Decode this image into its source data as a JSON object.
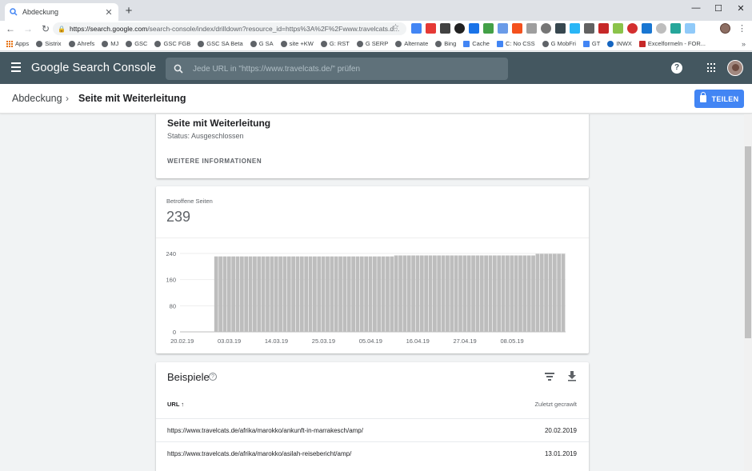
{
  "browser": {
    "tab_title": "Abdeckung",
    "new_tab": "+",
    "window_controls": [
      "—",
      "☐",
      "✕"
    ],
    "url_host": "https://search.google.com",
    "url_path": "/search-console/index/drilldown?resource_id=https%3A%2F%2Fwww.travelcats.d...",
    "bookmarks": [
      "Apps",
      "Sistrix",
      "Ahrefs",
      "MJ",
      "GSC",
      "GSC FGB",
      "GSC SA Beta",
      "G SA",
      "site +KW",
      "G: RST",
      "G SERP",
      "Alternate",
      "Bing",
      "Cache",
      "C: No CSS",
      "G MobFri",
      "GT",
      "INWX",
      "Excelformeln - FOR..."
    ],
    "more": "»"
  },
  "header": {
    "logo": "Google Search Console",
    "search_placeholder": "Jede URL in \"https://www.travelcats.de/\" prüfen",
    "help": "?"
  },
  "breadcrumb": {
    "parent": "Abdeckung",
    "separator": "›",
    "current": "Seite mit Weiterleitung"
  },
  "share_button": "TEILEN",
  "status_card": {
    "title": "Seite mit Weiterleitung",
    "status": "Status: Ausgeschlossen",
    "more_info": "WEITERE INFORMATIONEN"
  },
  "chart_card": {
    "label": "Betroffene Seiten",
    "value": "239"
  },
  "chart_data": {
    "type": "bar",
    "ylim": [
      0,
      240
    ],
    "yticks": [
      "240",
      "160",
      "80",
      "0"
    ],
    "xticks": [
      "20.02.19",
      "03.03.19",
      "14.03.19",
      "25.03.19",
      "05.04.19",
      "16.04.19",
      "27.04.19",
      "08.05.19"
    ],
    "first_date": "20.02.19",
    "days_total": 90,
    "zero_days": 8,
    "segments": [
      {
        "days": 42,
        "value": 231
      },
      {
        "days": 33,
        "value": 234
      },
      {
        "days": 7,
        "value": 239
      }
    ]
  },
  "examples": {
    "title": "Beispiele",
    "info": "?",
    "col_url": "URL",
    "sort": "↑",
    "col_crawl": "Zuletzt gecrawlt",
    "rows": [
      {
        "url": "https://www.travelcats.de/afrika/marokko/ankunft-in-marrakesch/amp/",
        "date": "20.02.2019"
      },
      {
        "url": "https://www.travelcats.de/afrika/marokko/asilah-reisebericht/amp/",
        "date": "13.01.2019"
      }
    ]
  },
  "colors": {
    "header_bg": "#445760",
    "accent": "#4285f4",
    "bar": "#bdbdbd"
  }
}
